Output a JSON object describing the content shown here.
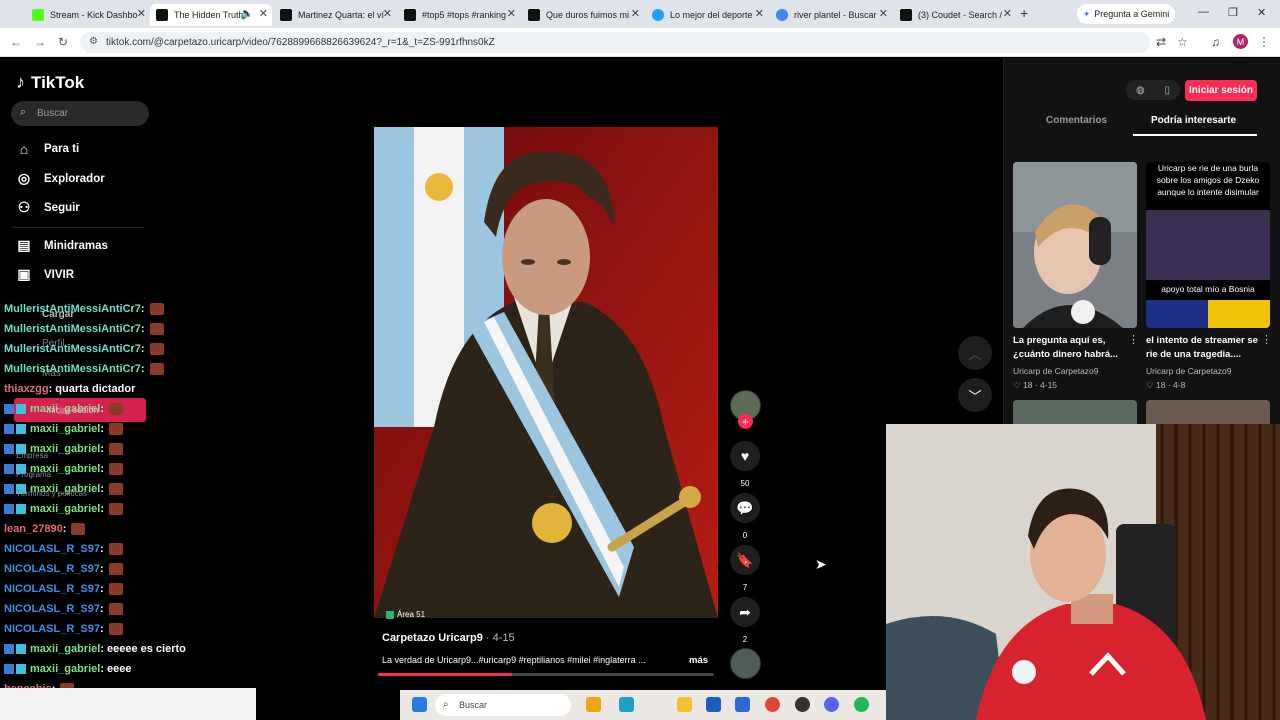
{
  "browser": {
    "tabs": [
      {
        "label": "Stream - Kick Dashbo",
        "color": "#53fc18"
      },
      {
        "label": "The Hidden Truth",
        "color": "#111111",
        "active": true
      },
      {
        "label": "Martinez Quarta: el ví",
        "color": "#111111"
      },
      {
        "label": "#top5 #tops #ranking",
        "color": "#111111"
      },
      {
        "label": "Que duros fuimos mi",
        "color": "#111111"
      },
      {
        "label": "Lo mejor del deporte",
        "color": "#1da1f2"
      },
      {
        "label": "river plantel - Buscar",
        "color": "#4285f4"
      },
      {
        "label": "(3) Coudet - Search /",
        "color": "#111111"
      }
    ],
    "gemini_label": "Pregunta a Gemini",
    "url": "tiktok.com/@carpetazo.uricarp/video/7628899668826639624?_r=1&_t=ZS-991rfhns0kZ",
    "profile_initial": "M"
  },
  "sidebar": {
    "brand": "TikTok",
    "search_placeholder": "Buscar",
    "nav": [
      {
        "label": "Para ti",
        "icon": "home-icon"
      },
      {
        "label": "Explorador",
        "icon": "compass-icon"
      },
      {
        "label": "Seguir",
        "icon": "follow-icon"
      },
      {
        "label": "Minidramas",
        "icon": "minidrama-icon"
      },
      {
        "label": "VIVIR",
        "icon": "live-icon"
      }
    ],
    "ghost": {
      "cargar": "Cargar",
      "perfil": "Perfil",
      "mas": "Más",
      "login": "Iniciar sesión",
      "empresa": "Empresa",
      "programa": "Programa",
      "terminos": "Términos y políticas"
    }
  },
  "chat": [
    {
      "user": "MulleristAntiMessiAntiCr7",
      "msg": "",
      "color": "#6ee0c8"
    },
    {
      "user": "MulleristAntiMessiAntiCr7",
      "msg": "",
      "color": "#6ee0c8"
    },
    {
      "user": "MulleristAntiMessiAntiCr7",
      "msg": "",
      "color": "#6ee0c8"
    },
    {
      "user": "MulleristAntiMessiAntiCr7",
      "msg": "",
      "color": "#6ee0c8"
    },
    {
      "user": "thiaxzgg",
      "msg": "quarta dictador",
      "color": "#e86a7a"
    },
    {
      "user": "maxii_gabriel",
      "msg": "",
      "color": "#7fe08a",
      "badges": true
    },
    {
      "user": "maxii_gabriel",
      "msg": "",
      "color": "#7fe08a",
      "badges": true
    },
    {
      "user": "maxii_gabriel",
      "msg": "",
      "color": "#7fe08a",
      "badges": true
    },
    {
      "user": "maxii_gabriel",
      "msg": "",
      "color": "#7fe08a",
      "badges": true
    },
    {
      "user": "maxii_gabriel",
      "msg": "",
      "color": "#7fe08a",
      "badges": true
    },
    {
      "user": "maxii_gabriel",
      "msg": "",
      "color": "#7fe08a",
      "badges": true
    },
    {
      "user": "lean_27890",
      "msg": "",
      "color": "#e86a7a"
    },
    {
      "user": "NICOLASL_R_S97",
      "msg": "",
      "color": "#3f8fe8"
    },
    {
      "user": "NICOLASL_R_S97",
      "msg": "",
      "color": "#3f8fe8"
    },
    {
      "user": "NICOLASL_R_S97",
      "msg": "",
      "color": "#3f8fe8"
    },
    {
      "user": "NICOLASL_R_S97",
      "msg": "",
      "color": "#3f8fe8"
    },
    {
      "user": "NICOLASL_R_S97",
      "msg": "",
      "color": "#3f8fe8"
    },
    {
      "user": "maxii_gabriel",
      "msg": "eeeee es cierto",
      "color": "#7fe08a",
      "badges": true
    },
    {
      "user": "maxii_gabriel",
      "msg": "eeee",
      "color": "#7fe08a",
      "badges": true
    },
    {
      "user": "beneabjs",
      "msg": "",
      "color": "#e86a7a"
    },
    {
      "user": "maxii_gabriel",
      "msg": "eee",
      "color": "#7fe08a",
      "badges": true
    }
  ],
  "video": {
    "label": "Área 51",
    "author": "Carpetazo Uricarp9",
    "date": "4-15",
    "description": "La verdad de Uricarp9...#uricarp9 #reptilianos #milei #inglaterra ...",
    "more": "más",
    "likes": "50",
    "comments": "0",
    "saves": "7",
    "shares": "2",
    "progress": 0.4
  },
  "right_panel": {
    "login": "Iniciar sesión",
    "tabs": [
      "Comentarios",
      "Podría interesarte"
    ],
    "cards": [
      {
        "title": "La pregunta aquí es, ¿cuánto dinero habrá...",
        "author": "Uricarp de Carpetazo9",
        "likes": "18",
        "date": "4-15"
      },
      {
        "title": "el intento de streamer se rie de una tragedia....",
        "author": "Uricarp de Carpetazo9",
        "likes": "18",
        "date": "4-8",
        "overlay_top": "Uricarp se rie de una burla sobre los amigos de Dzeko aunque lo intente disimular",
        "overlay_bottom": "apoyo total mío a Bosnia"
      }
    ]
  },
  "taskbar": {
    "search": "Buscar"
  }
}
